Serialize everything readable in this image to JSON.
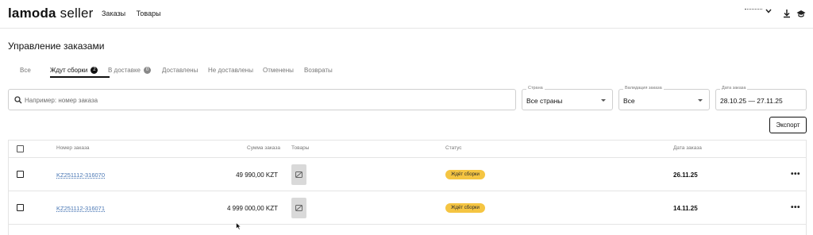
{
  "header": {
    "logo_brand": "lamoda",
    "logo_suffix": " seller",
    "nav": [
      "Заказы",
      "Товары"
    ],
    "user_name": "· · · · ·",
    "icons": [
      "chevron-down-icon",
      "download-icon",
      "graduation-cap-icon"
    ]
  },
  "page": {
    "title": "Управление заказами"
  },
  "tabs": [
    {
      "label": "Все"
    },
    {
      "label": "Ждут сборки",
      "badge": "2"
    },
    {
      "label": "В доставке",
      "badge": "0"
    },
    {
      "label": "Доставлены"
    },
    {
      "label": "Не доставлены"
    },
    {
      "label": "Отменены"
    },
    {
      "label": "Возвраты"
    }
  ],
  "filters": {
    "search_placeholder": "Например: номер заказа",
    "country": {
      "label": "Страна",
      "value": "Все страны"
    },
    "currency": {
      "label": "Валидация заказа",
      "value": "Все"
    },
    "date": {
      "label": "Дата заказа",
      "value": "28.10.25 — 27.11.25"
    }
  },
  "actions": {
    "export_label": "Экспорт"
  },
  "table": {
    "columns": [
      "Номер заказа",
      "Сумма заказа",
      "Товары",
      "Статус",
      "Дата заказа"
    ],
    "rows": [
      {
        "order": "KZ251112-316070",
        "sum": "49 990,00 KZT",
        "status": "Ждёт сборки",
        "date": "26.11.25"
      },
      {
        "order": "KZ251112-316071",
        "sum": "4 999 000,00 KZT",
        "status": "Ждёт сборки",
        "date": "14.11.25"
      }
    ]
  },
  "colors": {
    "status_badge": "#f5c542",
    "link": "#4a77b4",
    "tab_active": "#111111"
  }
}
